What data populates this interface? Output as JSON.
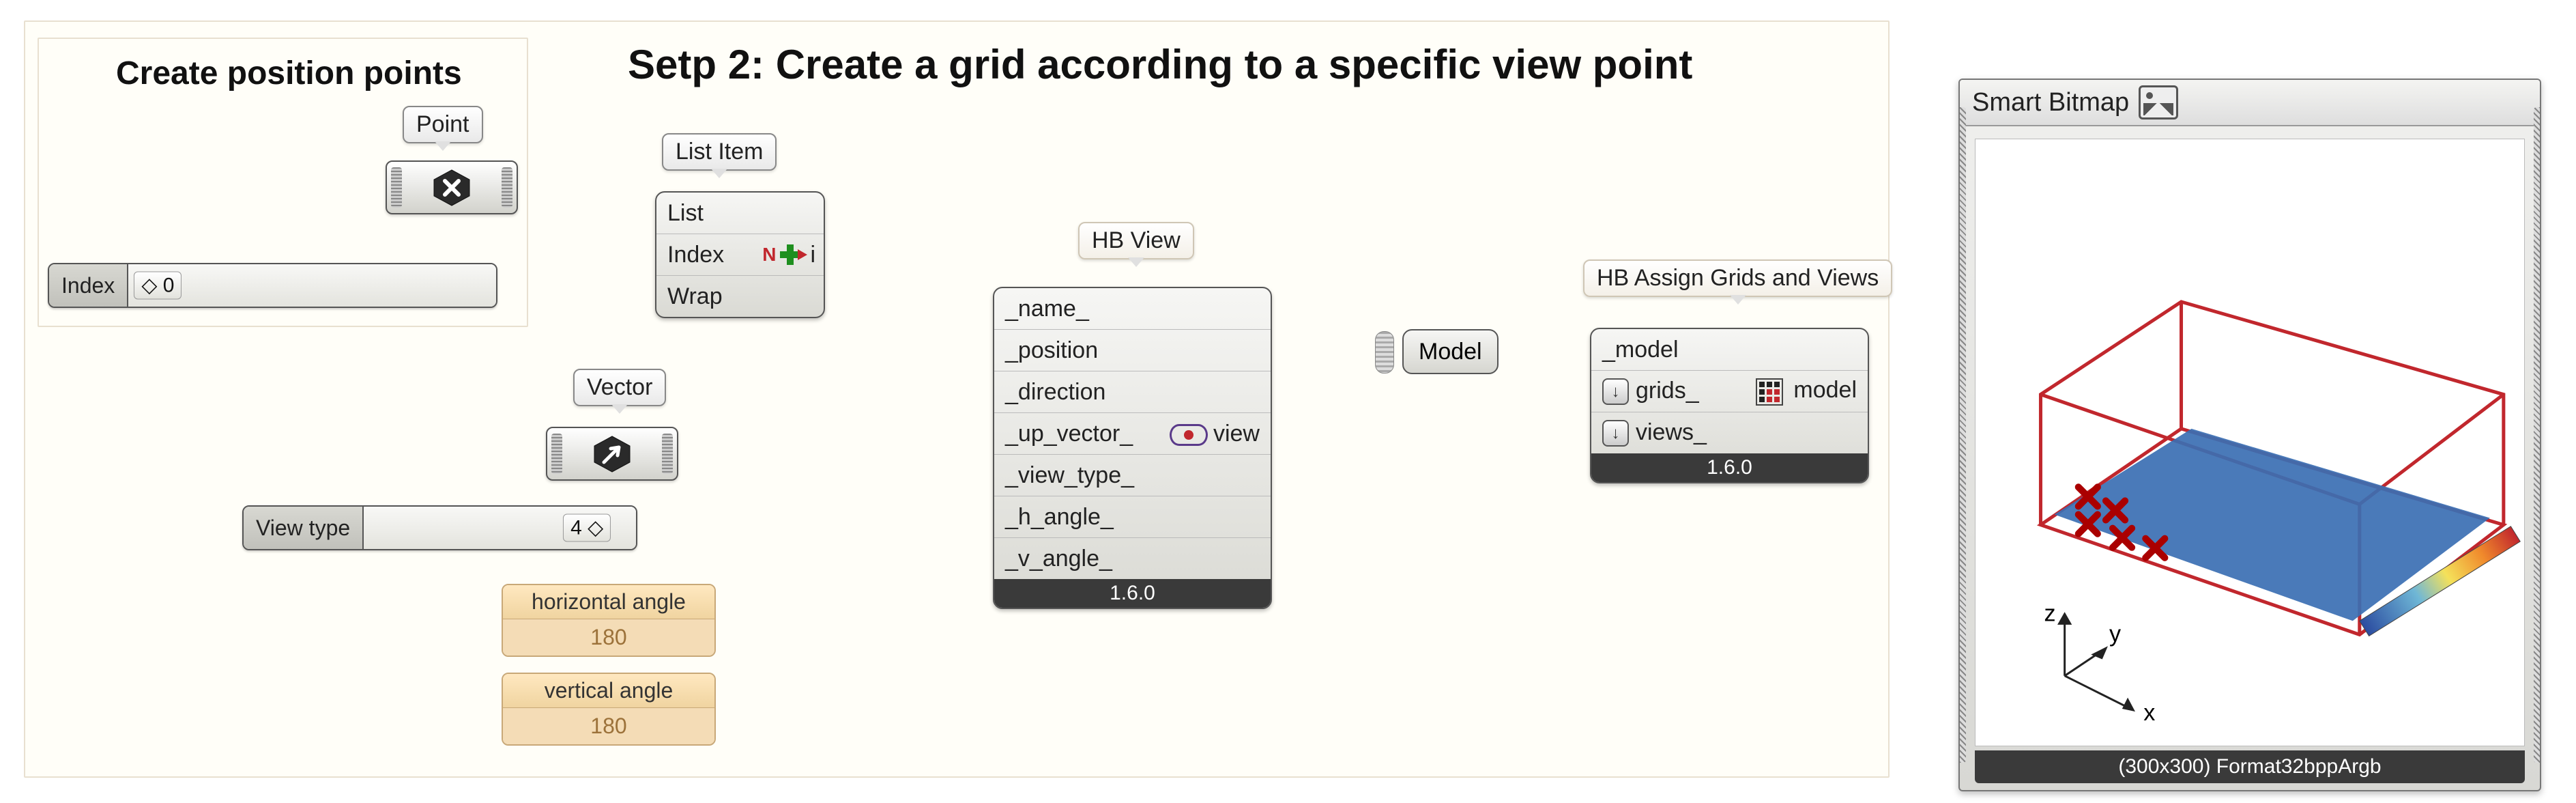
{
  "title": "Setp 2: Create a grid according to a specific view point",
  "group_label": "Create position points",
  "bubbles": {
    "point": "Point",
    "list_item": "List Item",
    "vector": "Vector",
    "hb_view": "HB View",
    "hb_assign": "HB Assign Grids and Views"
  },
  "sliders": {
    "index": {
      "label": "Index",
      "value": "0"
    },
    "viewtype": {
      "label": "View type",
      "value": "4"
    }
  },
  "tan": {
    "h": {
      "label": "horizontal angle",
      "value": "180"
    },
    "v": {
      "label": "vertical angle",
      "value": "180"
    }
  },
  "list_item": {
    "in": [
      "List",
      "Index",
      "Wrap"
    ],
    "out": "i",
    "letter": "N"
  },
  "hb_view": {
    "inputs": [
      "_name_",
      "_position",
      "_direction",
      "_up_vector_",
      "_view_type_",
      "_h_angle_",
      "_v_angle_"
    ],
    "out": "view",
    "version": "1.6.0"
  },
  "model_capsule": "Model",
  "hb_assign_comp": {
    "inputs": [
      "_model",
      "grids_",
      "views_"
    ],
    "out": "model",
    "version": "1.6.0"
  },
  "preview": {
    "title": "Smart Bitmap",
    "status": "(300x300) Format32bppArgb",
    "axes": {
      "x": "x",
      "y": "y",
      "z": "z"
    }
  }
}
